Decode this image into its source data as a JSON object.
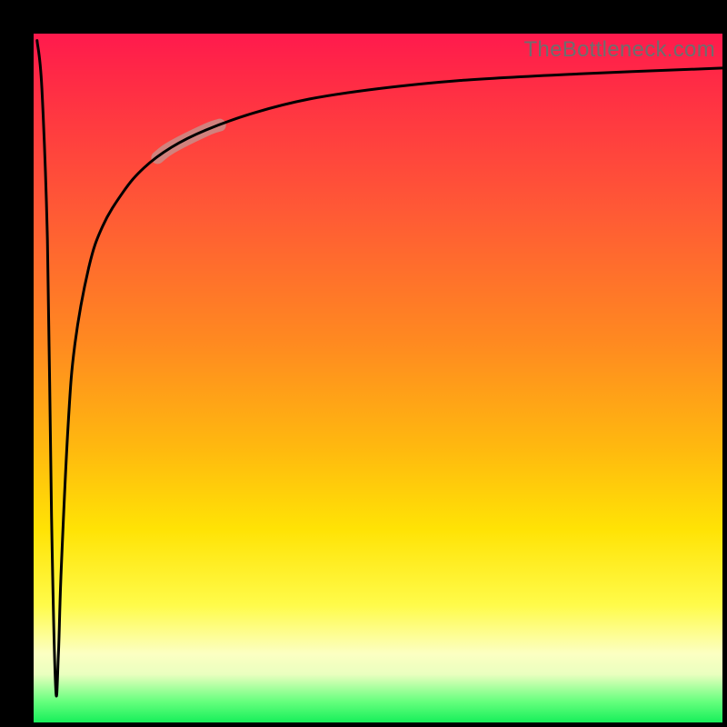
{
  "watermark": "TheBottleneck.com",
  "colors": {
    "frame": "#000000",
    "curve": "#000000",
    "highlight": "#c98d88",
    "gradient_top": "#ff1a4d",
    "gradient_mid": "#ffe305",
    "gradient_bottom": "#17ef5a"
  },
  "chart_data": {
    "type": "line",
    "title": "",
    "xlabel": "",
    "ylabel": "",
    "xlim": [
      0,
      100
    ],
    "ylim": [
      0,
      100
    ],
    "note": "Axes are unlabeled in the image. Curve values are estimated from pixel positions: a sharp notch near x≈3 dropping to y≈5, then a logarithmic-like rise toward y≈95 with a highlighted segment around x≈18–26.",
    "series": [
      {
        "name": "bottleneck-curve",
        "x": [
          0.5,
          1.2,
          2.0,
          2.6,
          3.2,
          3.6,
          4.0,
          5.0,
          6.0,
          8.0,
          10.0,
          13.0,
          16.0,
          20.0,
          25.0,
          32.0,
          40.0,
          50.0,
          62.0,
          78.0,
          100.0
        ],
        "y": [
          99.0,
          92.0,
          70.0,
          30.0,
          5.0,
          10.0,
          22.0,
          43.0,
          55.0,
          66.0,
          72.0,
          77.0,
          80.5,
          83.5,
          86.0,
          88.5,
          90.5,
          92.0,
          93.2,
          94.1,
          95.0
        ]
      }
    ],
    "highlight_range_x": [
      18,
      27
    ]
  }
}
